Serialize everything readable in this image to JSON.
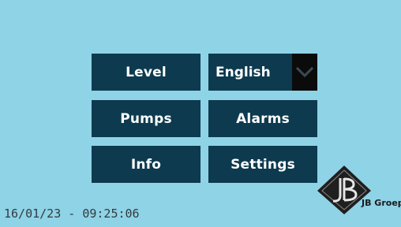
{
  "menu": {
    "level_label": "Level",
    "pumps_label": "Pumps",
    "info_label": "Info",
    "alarms_label": "Alarms",
    "settings_label": "Settings"
  },
  "language": {
    "selected": "English",
    "icon": "chevron-down-icon"
  },
  "status": {
    "datetime": "16/01/23 - 09:25:06"
  },
  "logo": {
    "text": "JB Groep"
  },
  "colors": {
    "background": "#8fd3e6",
    "button": "#0d3a4f",
    "button_text": "#ffffff",
    "dropdown_arrow_bg": "#0b0b0b"
  }
}
